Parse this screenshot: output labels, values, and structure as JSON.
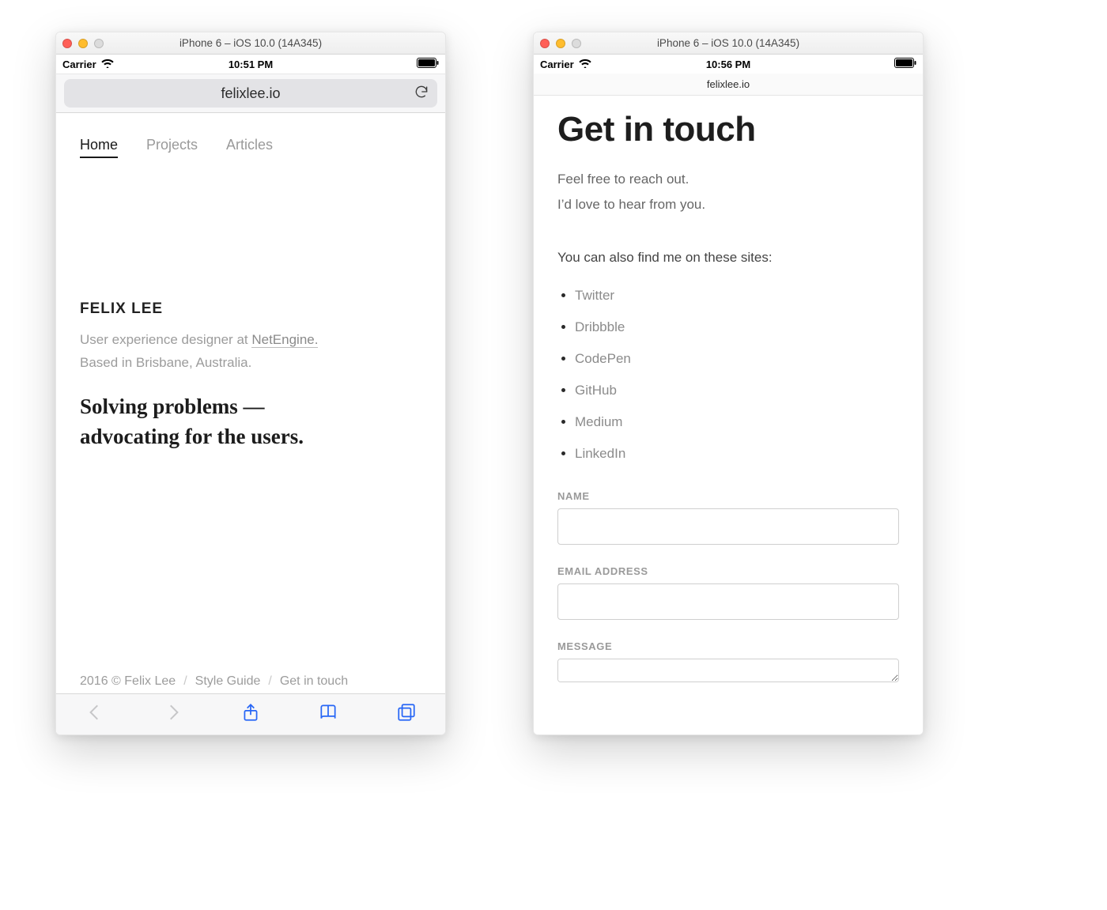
{
  "simulator": {
    "title": "iPhone 6 – iOS 10.0 (14A345)"
  },
  "left": {
    "status": {
      "carrier": "Carrier",
      "time": "10:51 PM"
    },
    "url": "felixlee.io",
    "nav": {
      "items": [
        {
          "label": "Home",
          "active": true
        },
        {
          "label": "Projects",
          "active": false
        },
        {
          "label": "Articles",
          "active": false
        }
      ]
    },
    "hero": {
      "brand": "FELIX LEE",
      "byline_prefix": "User experience designer at ",
      "byline_link": "NetEngine.",
      "byline_line2": "Based in Brisbane, Australia.",
      "tagline_line1": "Solving problems —",
      "tagline_line2": "advocating for the users."
    },
    "footer": {
      "copyright": "2016 © Felix Lee",
      "style_guide": "Style Guide",
      "contact": "Get in touch"
    }
  },
  "right": {
    "status": {
      "carrier": "Carrier",
      "time": "10:56 PM"
    },
    "url": "felixlee.io",
    "heading": "Get in touch",
    "lead_line1": "Feel free to reach out.",
    "lead_line2": "I’d love to hear from you.",
    "also": "You can also find me on these sites:",
    "links": [
      "Twitter",
      "Dribbble",
      "CodePen",
      "GitHub",
      "Medium",
      "LinkedIn"
    ],
    "form": {
      "name_label": "NAME",
      "email_label": "EMAIL ADDRESS",
      "message_label": "MESSAGE"
    }
  }
}
